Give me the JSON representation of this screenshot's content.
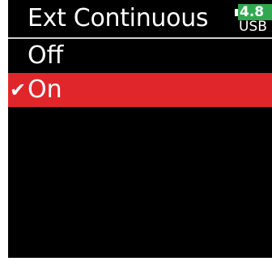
{
  "header": {
    "title": "Ext Continuous",
    "battery": {
      "level_text": "4.8",
      "source": "USB",
      "color": "#2fa84f"
    }
  },
  "menu": {
    "items": [
      {
        "label": "Off",
        "selected": false
      },
      {
        "label": "On",
        "selected": true
      }
    ],
    "checkmark": "✔",
    "highlight_color": "#e0262b"
  }
}
